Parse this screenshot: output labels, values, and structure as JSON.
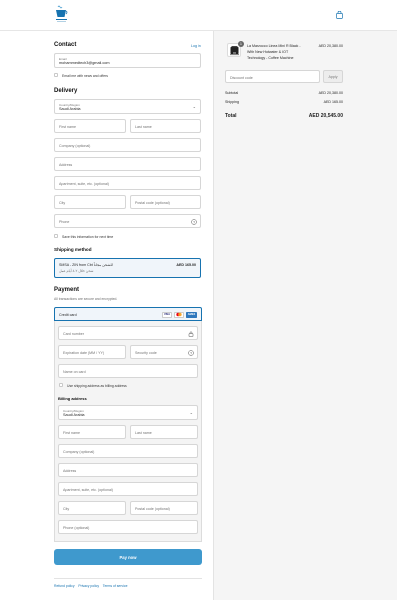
{
  "header": {
    "logo_icon": "coffee-cup-logo-icon",
    "cart_icon": "shopping-bag-icon"
  },
  "contact": {
    "title": "Contact",
    "login_link": "Log in",
    "email_label": "Email",
    "email_value": "mohammedtech3@gmail.com",
    "news_label": "Email me with news and offers"
  },
  "delivery": {
    "title": "Delivery",
    "country_label": "Country/Region",
    "country_value": "Saudi Arabia",
    "first_name": "First name",
    "last_name": "Last name",
    "company": "Company (optional)",
    "address": "Address",
    "apartment": "Apartment, suite, etc. (optional)",
    "city": "City",
    "postal": "Postal code (optional)",
    "phone": "Phone",
    "save_info": "Save this information for next time"
  },
  "shipping": {
    "title": "Shipping method",
    "option_line1": "SMSA - ZIN from Cbt للشحن مجاناً",
    "option_line2": "شحن خلال ٢-٤ أيام عمل",
    "option_price": "AED 165.00"
  },
  "payment": {
    "title": "Payment",
    "subtitle": "All transactions are secure and encrypted.",
    "method_label": "Credit card",
    "card_brands": [
      "VISA",
      "MC",
      "AMEX"
    ],
    "card_number": "Card number",
    "expiry": "Expiration date (MM / YY)",
    "security": "Security code",
    "name_on_card": "Name on card",
    "use_shipping": "Use shipping address as billing address"
  },
  "billing": {
    "title": "Billing address",
    "country_label": "Country/Region",
    "country_value": "Saudi Arabia",
    "first_name": "First name",
    "last_name": "Last name",
    "company": "Company (optional)",
    "address": "Address",
    "apartment": "Apartment, suite, etc. (optional)",
    "city": "City",
    "postal": "Postal code (optional)",
    "phone": "Phone (optional)"
  },
  "pay_button": "Pay now",
  "footer": {
    "links": [
      "Refund policy",
      "Privacy policy",
      "Terms of service"
    ]
  },
  "summary": {
    "quantity": "1",
    "product_line1": "La Marzocco Linea Mini R Black -",
    "product_line2": "With New Hotwater & IOT",
    "product_line3": "Technology - Coffee Machine",
    "product_price": "AED 20,380.00",
    "discount_placeholder": "Discount code",
    "apply_label": "Apply",
    "subtotal_label": "Subtotal",
    "subtotal_value": "AED 20,380.00",
    "shipping_label": "Shipping",
    "shipping_value": "AED 165.00",
    "total_label": "Total",
    "total_value": "AED 20,545.00"
  },
  "colors": {
    "accent": "#1773b0",
    "button": "#3f99cd",
    "summary_bg": "#f5f5f5"
  }
}
